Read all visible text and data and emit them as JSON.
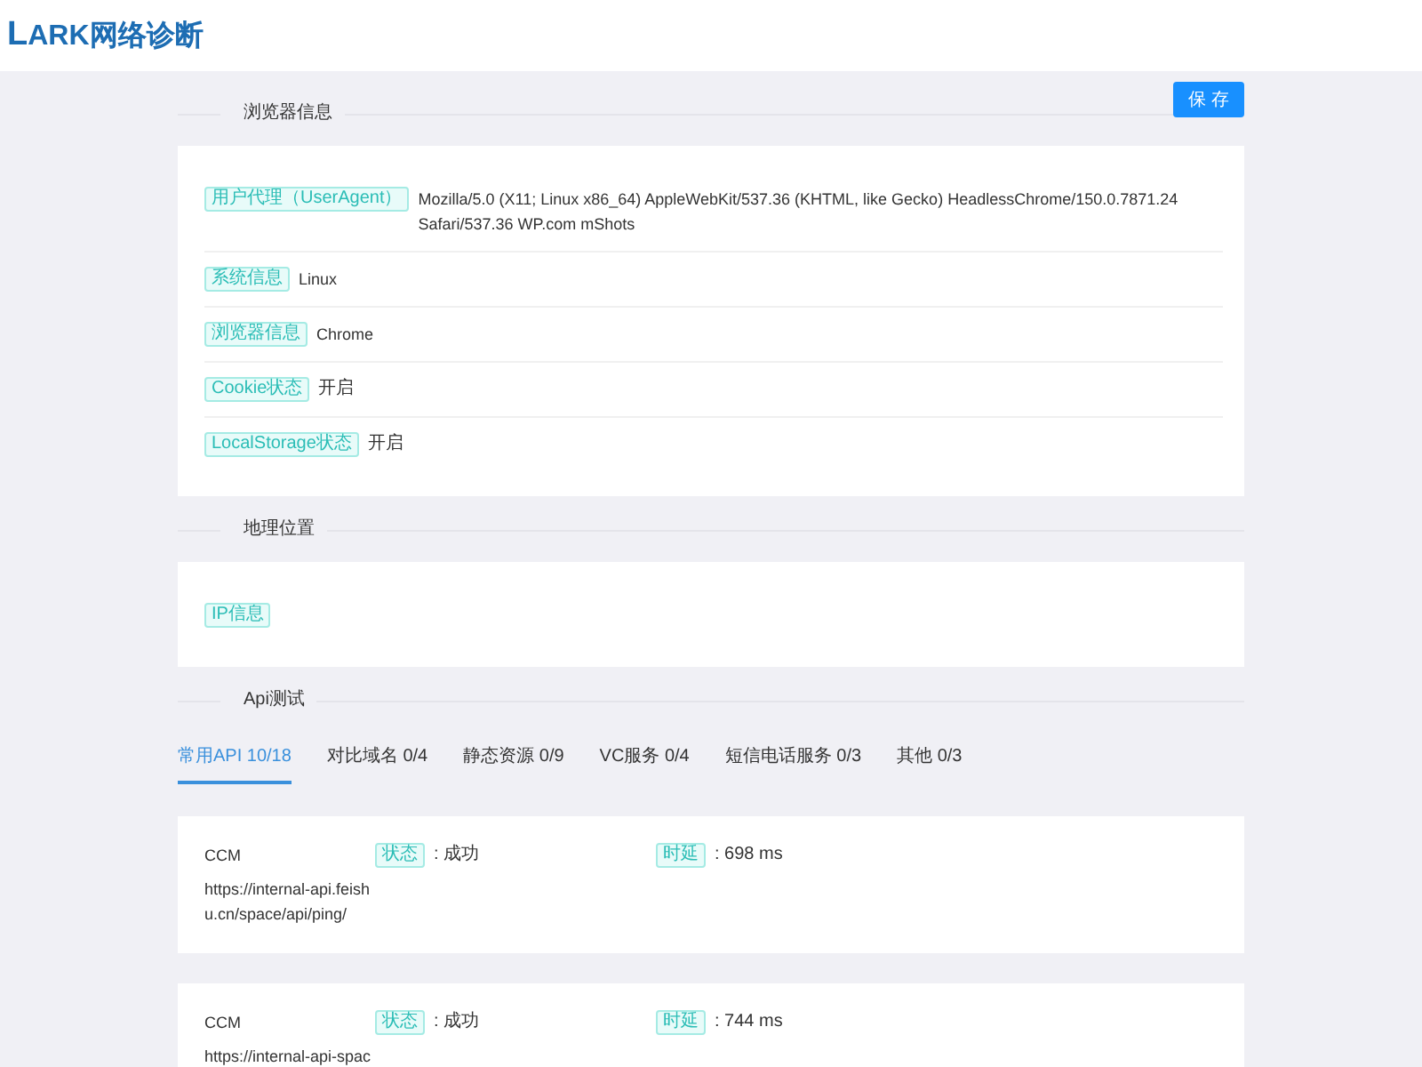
{
  "header": {
    "logo": "LARK网络诊断"
  },
  "save_button": "保 存",
  "sections": [
    {
      "kind": "info",
      "title": "浏览器信息",
      "rows": [
        {
          "label": "用户代理（UserAgent）",
          "value": "Mozilla/5.0 (X11; Linux x86_64) AppleWebKit/537.36 (KHTML, like Gecko) HeadlessChrome/150.0.7871.24 Safari/537.36 WP.com mShots"
        },
        {
          "label": "系统信息",
          "value": "Linux"
        },
        {
          "label": "浏览器信息",
          "value": "Chrome"
        },
        {
          "label": "Cookie状态",
          "value": "开启"
        },
        {
          "label": "LocalStorage状态",
          "value": "开启"
        }
      ]
    },
    {
      "kind": "info",
      "title": "地理位置",
      "rows": [
        {
          "label": "IP信息"
        }
      ]
    },
    {
      "kind": "api",
      "title": "Api测试",
      "tabs": [
        {
          "label": "常用API 10/18",
          "selected": true
        },
        {
          "label": "对比域名 0/4",
          "selected": false
        },
        {
          "label": "静态资源 0/9",
          "selected": false
        },
        {
          "label": "VC服务 0/4",
          "selected": false
        },
        {
          "label": "短信电话服务 0/3",
          "selected": false
        },
        {
          "label": "其他 0/3",
          "selected": false
        }
      ],
      "results": [
        {
          "name": "CCM",
          "status_label": "状态",
          "status": ": 成功",
          "latency_label": "时延",
          "latency": ": 698 ms",
          "url": "https://internal-api.feishu.cn/space/api/ping/"
        },
        {
          "name": "CCM",
          "status_label": "状态",
          "status": ": 成功",
          "latency_label": "时延",
          "latency": ": 744 ms",
          "url": "https://internal-api-spac"
        }
      ]
    }
  ]
}
